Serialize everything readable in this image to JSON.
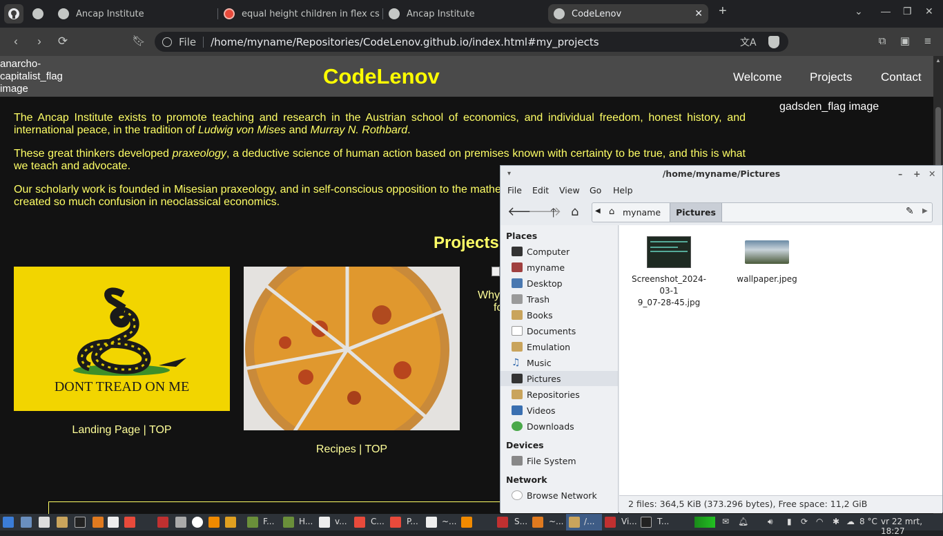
{
  "browser": {
    "tabs": [
      {
        "title": "Ancap Institute"
      },
      {
        "title": "equal height children in flex css - B"
      },
      {
        "title": "Ancap Institute"
      },
      {
        "title": "CodeLenov"
      }
    ],
    "new_tab": "+",
    "file_label": "File",
    "url": "/home/myname/Repositories/CodeLenov.github.io/index.html#my_projects"
  },
  "site": {
    "logo_alt": "anarcho-capitalist_flag image",
    "title": "CodeLenov",
    "nav": [
      "Welcome",
      "Projects",
      "Contact"
    ],
    "side_alt": "gadsden_flag image",
    "p1a": "The Ancap Institute exists to promote teaching and research in the Austrian school of economics, and individual freedom, honest history, and international peace, in the tradition of ",
    "p1b": "Ludwig von Mises",
    "p1c": " and ",
    "p1d": "Murray N. Rothbard",
    "p1e": ".",
    "p2a": "These great thinkers developed ",
    "p2b": "praxeology",
    "p2c": ", a deductive science of human action based on premises known with certainty to be true, and this is what we teach and advocate.",
    "p3": "Our scholarly work is founded in Misesian praxeology, and in self-conscious opposition to the mathe",
    "p3b": "created so much confusion in neoclassical economics.",
    "projects_heading": "Projects",
    "gadsden_motto": "DONT TREAD ON ME",
    "project1_link": "Landing Page",
    "project1_top": "TOP",
    "project2_link": "Recipes",
    "project2_top": "TOP",
    "project3_partial1": "Why",
    "project3_partial2": "fo"
  },
  "file_manager": {
    "title": "/home/myname/Pictures",
    "menu": [
      "File",
      "Edit",
      "View",
      "Go",
      "Help"
    ],
    "crumbs": [
      "myname",
      "Pictures"
    ],
    "places_heading": "Places",
    "places": [
      "Computer",
      "myname",
      "Desktop",
      "Trash",
      "Books",
      "Documents",
      "Emulation",
      "Music",
      "Pictures",
      "Repositories",
      "Videos",
      "Downloads"
    ],
    "devices_heading": "Devices",
    "devices": [
      "File System"
    ],
    "network_heading": "Network",
    "network": [
      "Browse Network"
    ],
    "files": [
      {
        "name1": "Screenshot_2024-03-1",
        "name2": "9_07-28-45.jpg"
      },
      {
        "name1": "wallpaper.jpeg",
        "name2": ""
      }
    ],
    "status": "2 files: 364,5 KiB (373.296 bytes), Free space: 11,2 GiB"
  },
  "taskbar": {
    "labels": [
      "F...",
      "H...",
      "v...",
      "C...",
      "P...",
      "~...",
      "S...",
      "~...",
      "/...",
      "Vi...",
      "T..."
    ],
    "weather": "8 °C",
    "clock": "vr 22 mrt, 18:27"
  },
  "colors": {
    "accent_yellow": "#ffff00",
    "page_bg": "#121212",
    "header_bg": "#4a4a4a"
  }
}
